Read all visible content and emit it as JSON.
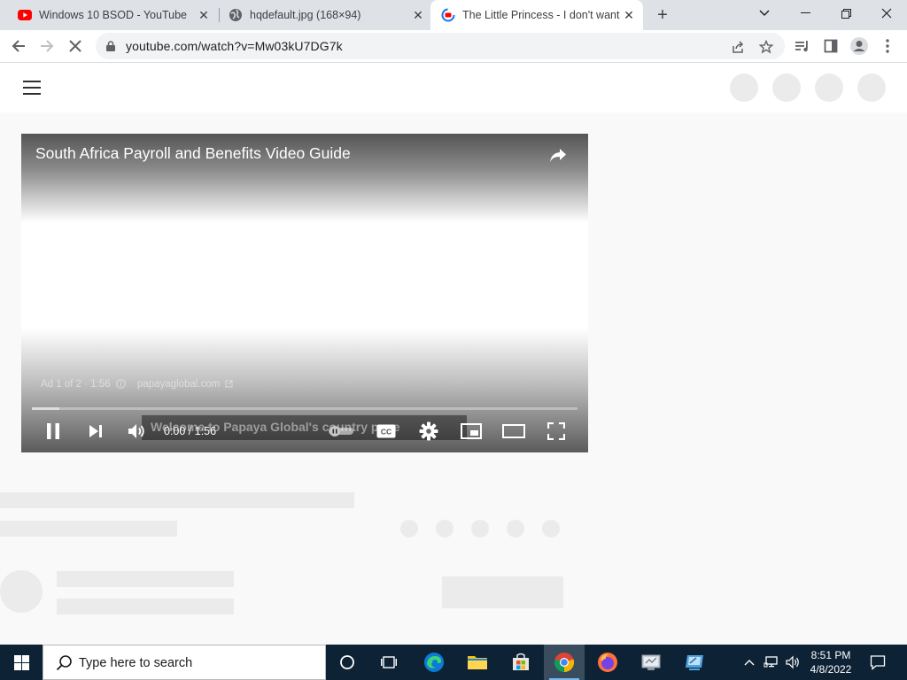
{
  "browser": {
    "tabs": [
      {
        "title": "Windows 10 BSOD - YouTube",
        "favicon": "youtube-icon",
        "active": false
      },
      {
        "title": "hqdefault.jpg (168×94)",
        "favicon": "globe-icon",
        "active": false
      },
      {
        "title": "The Little Princess - I don't want",
        "favicon": "youtube-loading-icon",
        "active": true
      }
    ],
    "url": "youtube.com/watch?v=Mw03kU7DG7k"
  },
  "player": {
    "title": "South Africa Payroll and Benefits Video Guide",
    "ad_info": "Ad 1 of 2 · 1:56",
    "ad_link": "papayaglobal.com",
    "subtitle": "Welcome to Papaya Global's country page",
    "time": "0:00 / 1:56",
    "progress": 0.05
  },
  "taskbar": {
    "search_placeholder": "Type here to search",
    "time": "8:51 PM",
    "date": "4/8/2022"
  },
  "colors": {
    "youtube_red": "#ff0000",
    "taskbar_bg": "#0e2235",
    "tabstrip_bg": "#dee1e6"
  }
}
